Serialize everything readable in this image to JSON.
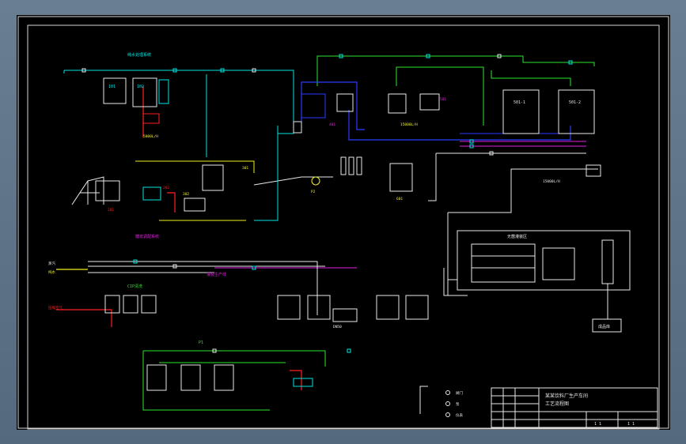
{
  "drawing": {
    "title_line1": "某某饮料厂生产车间",
    "title_line2": "工艺流程图",
    "sheet_info": "1 1",
    "sheet_info_right": "1 1"
  },
  "sections": {
    "water_treatment": "纯水处理系统",
    "syrup_prep": "糖浆调配系统",
    "cip_label": "CIP清洗",
    "filling_line": "灌装生产线",
    "sterile_area": "无菌灌装区"
  },
  "equipment": {
    "t101": "101",
    "t102": "102",
    "t103": "103",
    "t201": "201",
    "t202": "202",
    "t301": "301",
    "t302": "302",
    "t401": "401",
    "t501": "501",
    "t601": "601",
    "silo_1": "501-1",
    "silo_2": "501-2",
    "receiver": "成品库"
  },
  "tags": {
    "steam": "蒸汽",
    "water": "纯水",
    "air": "压缩空气",
    "pump_1": "P1",
    "pump_2": "P2",
    "flow_1": "5000L/H",
    "flow_2": "15000L/H",
    "pipe_no": "DN50"
  },
  "legend": {
    "item1": "阀门",
    "item2": "泵",
    "item3": "仪表"
  },
  "colors": {
    "cyan": "#00e5e5",
    "green": "#2ee62e",
    "magenta": "#e01ee0",
    "blue": "#2a3dff",
    "yellow": "#f0f020",
    "red": "#ff2020",
    "white": "#e8e8e8",
    "orange": "#ff9900"
  }
}
